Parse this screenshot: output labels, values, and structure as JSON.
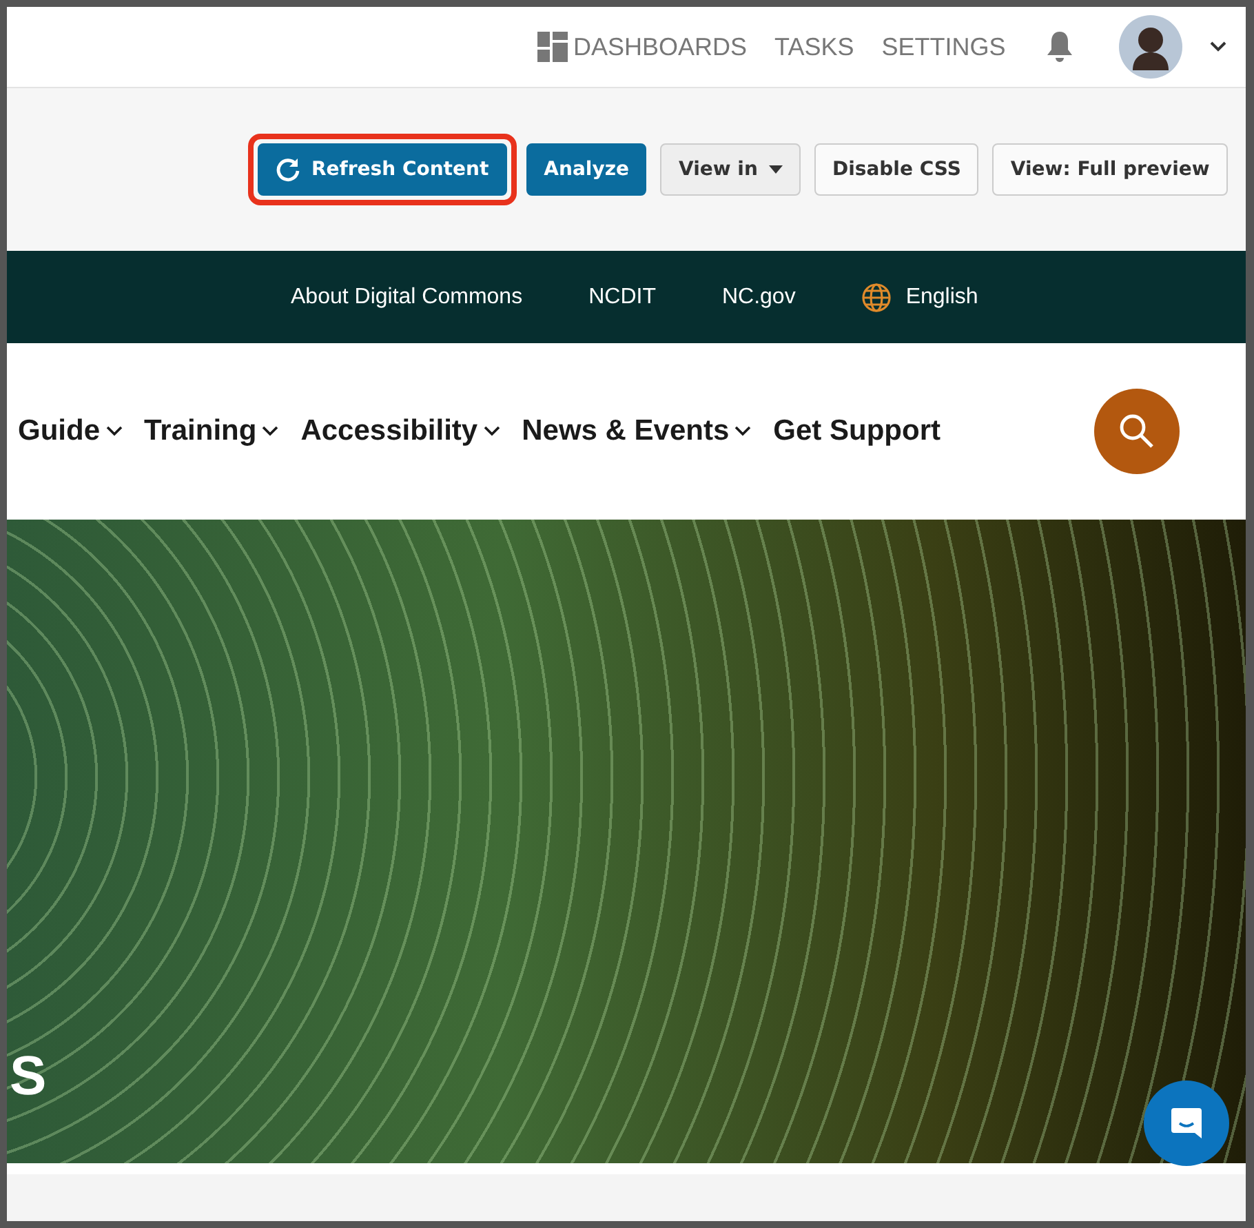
{
  "top_nav": {
    "links": [
      {
        "label": "DASHBOARDS",
        "kind": "dashboards"
      },
      {
        "label": "TASKS",
        "kind": "plain"
      },
      {
        "label": "SETTINGS",
        "kind": "plain"
      }
    ]
  },
  "toolbar": {
    "buttons": [
      {
        "label": "Refresh Content",
        "kind": "primary",
        "highlighted": true
      },
      {
        "label": "Analyze",
        "kind": "primary",
        "highlighted": false
      },
      {
        "label": "View in",
        "kind": "dropdown",
        "highlighted": false
      },
      {
        "label": "Disable CSS",
        "kind": "secondary",
        "highlighted": false
      },
      {
        "label": "View: Full preview",
        "kind": "secondary",
        "highlighted": false
      }
    ]
  },
  "utility_bar": {
    "links": [
      {
        "label": "About Digital Commons",
        "kind": "plain"
      },
      {
        "label": "NCDIT",
        "kind": "plain"
      },
      {
        "label": "NC.gov",
        "kind": "plain"
      },
      {
        "label": "English",
        "kind": "language"
      }
    ]
  },
  "main_nav": {
    "items": [
      {
        "label": "Guide",
        "has_menu": true
      },
      {
        "label": "Training",
        "has_menu": true
      },
      {
        "label": "Accessibility",
        "has_menu": true
      },
      {
        "label": "News & Events",
        "has_menu": true
      },
      {
        "label": "Get Support",
        "has_menu": false
      }
    ]
  },
  "hero": {
    "heading_fragment": "S"
  }
}
